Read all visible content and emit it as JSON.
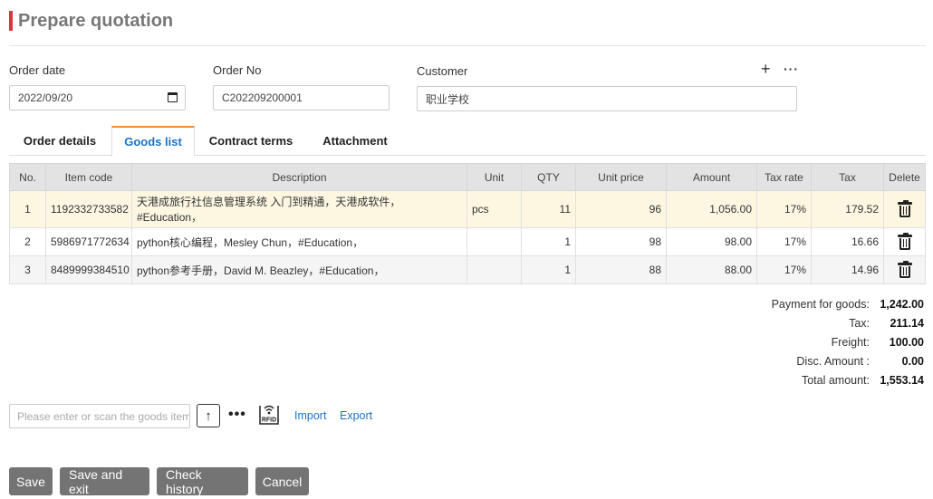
{
  "page": {
    "title": "Prepare quotation"
  },
  "form": {
    "order_date_label": "Order date",
    "order_date_value": "2022/09/20",
    "order_no_label": "Order No",
    "order_no_value": "C202209200001",
    "customer_label": "Customer",
    "customer_value": "职业学校",
    "add_glyph": "+",
    "more_glyph": "···"
  },
  "tabs": [
    {
      "label": "Order details",
      "active": false
    },
    {
      "label": "Goods list",
      "active": true
    },
    {
      "label": "Contract terms",
      "active": false
    },
    {
      "label": "Attachment",
      "active": false
    }
  ],
  "table": {
    "headers": [
      "No.",
      "Item code",
      "Description",
      "Unit",
      "QTY",
      "Unit price",
      "Amount",
      "Tax rate",
      "Tax",
      "Delete"
    ],
    "rows": [
      {
        "no": "1",
        "code": "1192332733582",
        "desc_line1": "天港成旅行社信息管理系统 入门到精通，天港成软件，",
        "desc_line2": "#Education，",
        "unit": "pcs",
        "qty": "11",
        "unit_price": "96",
        "amount": "1,056.00",
        "tax_rate": "17%",
        "tax": "179.52"
      },
      {
        "no": "2",
        "code": "5986971772634",
        "desc_line1": "python核心编程，Mesley Chun，#Education，",
        "desc_line2": "",
        "unit": "",
        "qty": "1",
        "unit_price": "98",
        "amount": "98.00",
        "tax_rate": "17%",
        "tax": "16.66"
      },
      {
        "no": "3",
        "code": "8489999384510",
        "desc_line1": "python参考手册，David M. Beazley，#Education，",
        "desc_line2": "",
        "unit": "",
        "qty": "1",
        "unit_price": "88",
        "amount": "88.00",
        "tax_rate": "17%",
        "tax": "14.96"
      }
    ]
  },
  "summary": {
    "payment_label": "Payment for goods:",
    "payment_value": "1,242.00",
    "tax_label": "Tax:",
    "tax_value": "211.14",
    "freight_label": "Freight:",
    "freight_value": "100.00",
    "disc_label": "Disc. Amount :",
    "disc_value": "0.00",
    "total_label": "Total amount:",
    "total_value": "1,553.14"
  },
  "toolbar": {
    "scan_placeholder": "Please enter or scan the goods item",
    "upload_glyph": "↑",
    "more_glyph": "•••",
    "rfid_text": "RFID",
    "import_label": "Import",
    "export_label": "Export"
  },
  "buttons": {
    "save": "Save",
    "save_exit": "Save and exit",
    "check_history": "Check history",
    "cancel": "Cancel"
  }
}
